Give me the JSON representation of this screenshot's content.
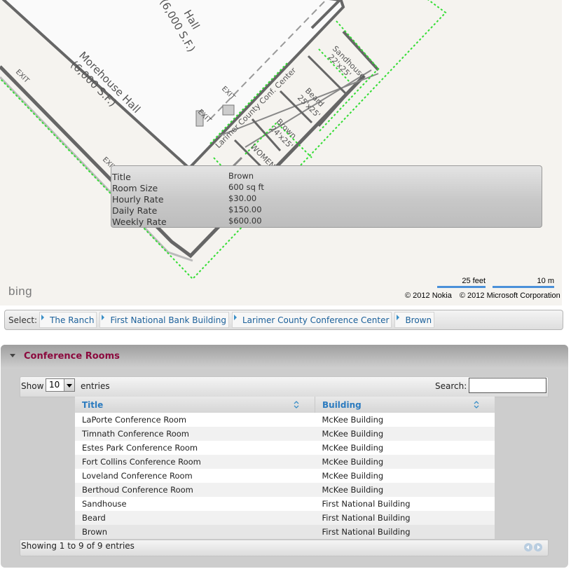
{
  "map": {
    "hall_top_label": "Hall",
    "hall_top_size": "(6,000 S.F.)",
    "morehouse_name": "Morehouse Hall",
    "morehouse_size": "(6,000 S.F.)",
    "conference_center_label": "Larimer County Conf. Center",
    "room_sandhouse": "Sandhouse",
    "room_sandhouse_size": "22'x25'",
    "room_beard": "Beard",
    "room_beard_size": "25'x25'",
    "room_brown": "Brown",
    "room_brown_size": "24'x25'",
    "room_women": "WOMEN",
    "exit_label": "EXIT",
    "bing_logo": "bing",
    "scale_feet": "25 feet",
    "scale_meters": "10 m",
    "copyright_nokia": "© 2012 Nokia",
    "copyright_microsoft": "© 2012 Microsoft Corporation",
    "outline_color": "#33dd33"
  },
  "info_popup": {
    "rows": [
      {
        "key": "Title",
        "value": "Brown"
      },
      {
        "key": "Room Size",
        "value": "600 sq ft"
      },
      {
        "key": "Hourly Rate",
        "value": "$30.00"
      },
      {
        "key": "Daily Rate",
        "value": "$150.00"
      },
      {
        "key": "Weekly Rate",
        "value": "$600.00"
      }
    ]
  },
  "breadcrumb": {
    "label": "Select:",
    "items": [
      "The Ranch",
      "First National Bank Building",
      "Larimer County Conference Center",
      "Brown"
    ]
  },
  "panel": {
    "title": "Conference Rooms",
    "show_label": "Show",
    "entries_value": "10",
    "entries_label": "entries",
    "search_label": "Search:",
    "search_value": "",
    "columns": [
      "Title",
      "Building"
    ],
    "rows": [
      [
        "LaPorte Conference Room",
        "McKee Building"
      ],
      [
        "Timnath Conference Room",
        "McKee Building"
      ],
      [
        "Estes Park Conference Room",
        "McKee Building"
      ],
      [
        "Fort Collins Conference Room",
        "McKee Building"
      ],
      [
        "Loveland Conference Room",
        "McKee Building"
      ],
      [
        "Berthoud Conference Room",
        "McKee Building"
      ],
      [
        "Sandhouse",
        "First National Building"
      ],
      [
        "Beard",
        "First National Building"
      ],
      [
        "Brown",
        "First National Building"
      ]
    ],
    "footer_info": "Showing 1 to 9 of 9 entries",
    "title_color": "#8b0a3e",
    "link_color": "#2c7bbf"
  }
}
